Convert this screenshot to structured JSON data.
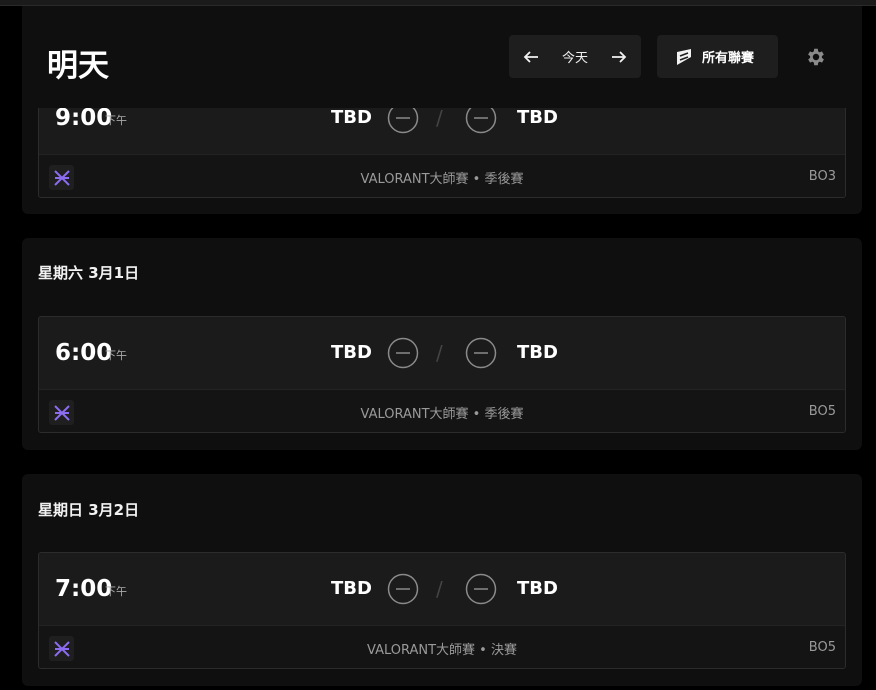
{
  "header": {
    "title": "明天",
    "today_label": "今天",
    "leagues_label": "所有聯賽"
  },
  "days": [
    {
      "label": "",
      "match": {
        "time": "9:00",
        "ampm": "下午",
        "team_left": "TBD",
        "team_right": "TBD",
        "league": "VALORANT大師賽 • 季後賽",
        "bo": "BO3"
      }
    },
    {
      "label": "星期六 3月1日",
      "match": {
        "time": "6:00",
        "ampm": "下午",
        "team_left": "TBD",
        "team_right": "TBD",
        "league": "VALORANT大師賽 • 季後賽",
        "bo": "BO5"
      }
    },
    {
      "label": "星期日 3月2日",
      "match": {
        "time": "7:00",
        "ampm": "下午",
        "team_left": "TBD",
        "team_right": "TBD",
        "league": "VALORANT大師賽 • 決賽",
        "bo": "BO5"
      }
    }
  ],
  "icons": {
    "prev": "arrow-left-icon",
    "next": "arrow-right-icon",
    "leagues": "leagues-flag-icon",
    "settings": "gear-icon",
    "team_placeholder": "team-placeholder-icon",
    "league_logo": "valorant-masters-icon"
  },
  "colors": {
    "accent": "#8c6cf0"
  }
}
